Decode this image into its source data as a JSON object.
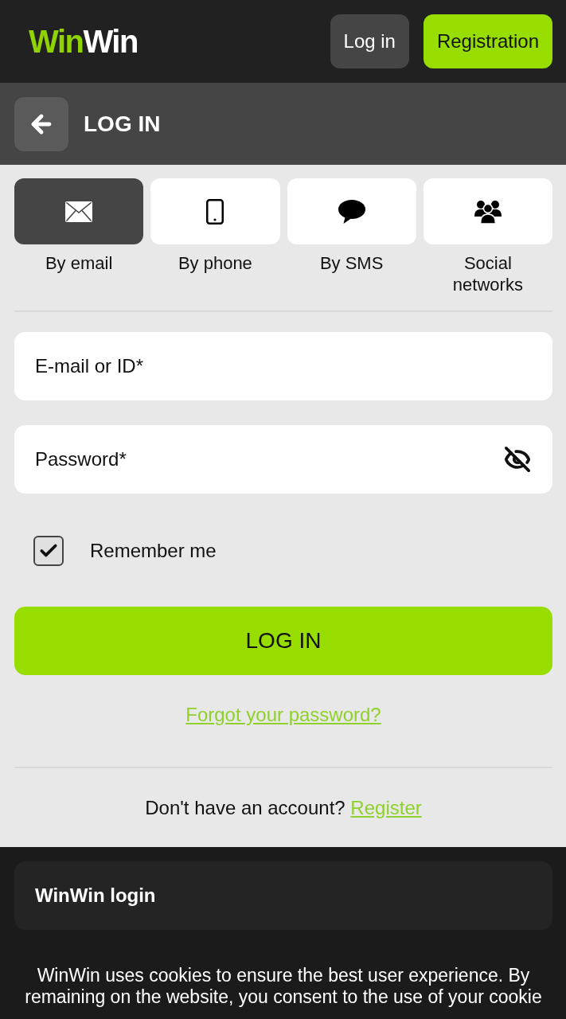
{
  "header": {
    "logo": [
      {
        "text": "Win",
        "color": "#8fd400"
      },
      {
        "text": "Win",
        "color": "#ffffff"
      }
    ],
    "buttons": [
      {
        "label": "Log in",
        "kind": "secondary"
      },
      {
        "label": "Registration",
        "kind": "primary"
      }
    ]
  },
  "page_header": {
    "title": "LOG IN"
  },
  "login_methods": [
    {
      "kind": "email",
      "label": "By email",
      "selected": true
    },
    {
      "kind": "phone",
      "label": "By phone",
      "selected": false
    },
    {
      "kind": "sms",
      "label": "By SMS",
      "selected": false
    },
    {
      "kind": "social",
      "label": "Social networks",
      "selected": false
    }
  ],
  "form": {
    "fields": [
      {
        "kind": "text",
        "placeholder": "E-mail or ID*"
      },
      {
        "kind": "password",
        "placeholder": "Password*"
      }
    ],
    "remember": {
      "label": "Remember me",
      "checked": true
    },
    "submit": "LOG IN",
    "forgot_link": "Forgot your password?"
  },
  "signup": {
    "text": "Don't have an account?",
    "link": "Register"
  },
  "footer": {
    "card_title": "WinWin login",
    "cookie_notice": "WinWin uses cookies to ensure the best user experience. By remaining on the website, you consent to the use of your cookie"
  }
}
